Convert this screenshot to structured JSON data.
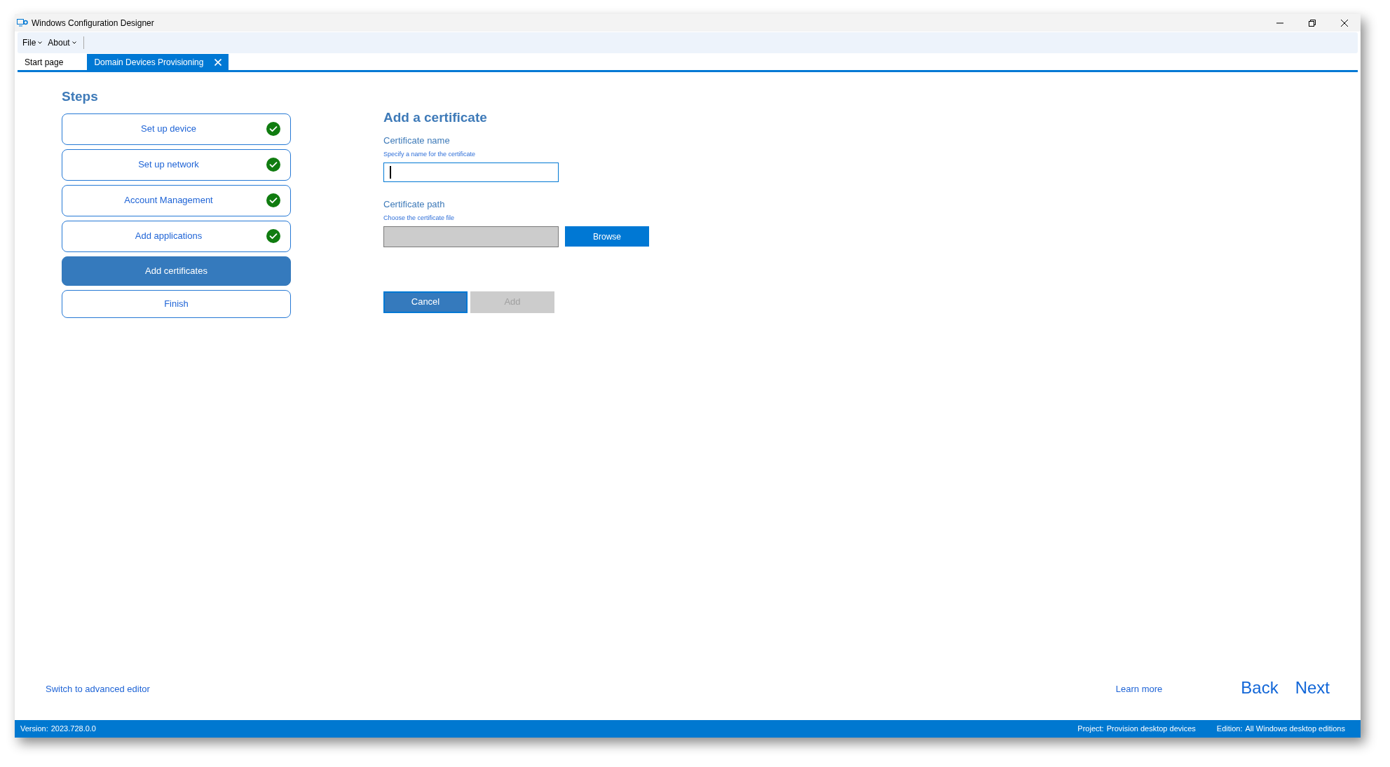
{
  "window": {
    "title": "Windows Configuration Designer"
  },
  "menu": [
    {
      "label": "File"
    },
    {
      "label": "About"
    }
  ],
  "tabs": [
    {
      "label": "Start page",
      "selected": false,
      "closable": false
    },
    {
      "label": "Domain Devices Provisioning",
      "selected": true,
      "closable": true
    }
  ],
  "steps": {
    "title": "Steps",
    "items": [
      {
        "label": "Set up device",
        "selected": false,
        "completed": true
      },
      {
        "label": "Set up network",
        "selected": false,
        "completed": true
      },
      {
        "label": "Account Management",
        "selected": false,
        "completed": true
      },
      {
        "label": "Add applications",
        "selected": false,
        "completed": true
      },
      {
        "label": "Add certificates",
        "selected": true,
        "completed": false
      },
      {
        "label": "Finish",
        "selected": false,
        "completed": false
      }
    ]
  },
  "form": {
    "title": "Add a certificate",
    "fields": [
      {
        "label": "Certificate name",
        "hint": "Specify a name for the certificate",
        "focused": true,
        "disabled": false
      },
      {
        "label": "Certificate path",
        "hint": "Choose the certificate file",
        "focused": false,
        "disabled": true,
        "button": "Browse"
      }
    ],
    "buttons": [
      {
        "label": "Cancel",
        "disabled": false
      },
      {
        "label": "Add",
        "disabled": true
      }
    ]
  },
  "footer": {
    "advanced_link": "Switch to advanced editor",
    "learn_more": "Learn more",
    "back": "Back",
    "next": "Next"
  },
  "status_bar": [
    {
      "label": "Version:",
      "value": "2023.728.0.0"
    },
    {
      "label": "Project:",
      "value": "Provision desktop devices"
    },
    {
      "label": "Edition:",
      "value": "All Windows desktop editions"
    }
  ]
}
